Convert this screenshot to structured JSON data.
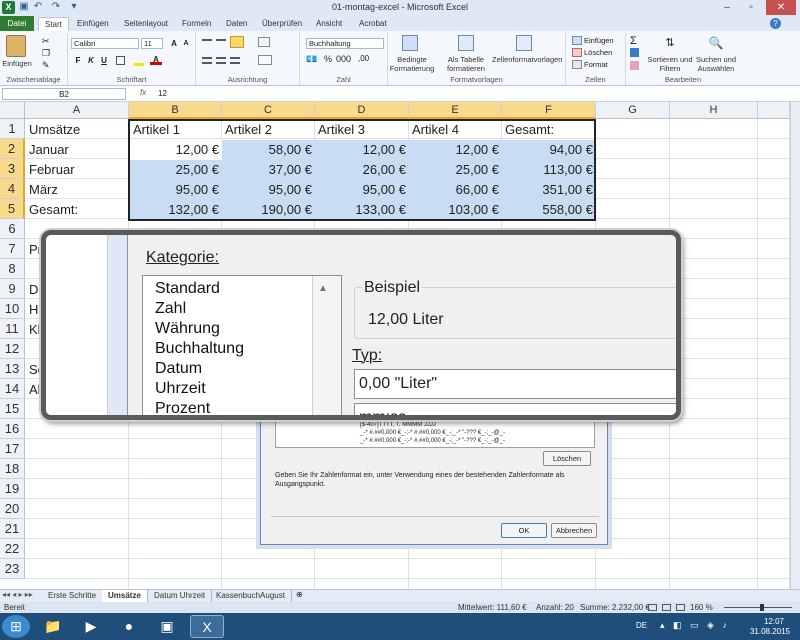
{
  "window": {
    "title": "01-montag-excel - Microsoft Excel"
  },
  "ribbon_tabs": [
    "Start",
    "Einfügen",
    "Seitenlayout",
    "Formeln",
    "Daten",
    "Überprüfen",
    "Ansicht",
    "Acrobat"
  ],
  "file_tab": "Datei",
  "ribbon": {
    "clipboard": {
      "paste": "Einfügen",
      "label": "Zwischenablage"
    },
    "font": {
      "name": "Calibri",
      "size": "11",
      "label": "Schriftart",
      "bold": "F",
      "italic": "K",
      "underline": "U"
    },
    "alignment": {
      "label": "Ausrichtung"
    },
    "number": {
      "format": "Buchhaltung",
      "label": "Zahl"
    },
    "styles": {
      "cond": "Bedingte Formatierung",
      "table": "Als Tabelle formatieren",
      "cell": "Zellenformatvorlagen",
      "label": "Formatvorlagen"
    },
    "cells": {
      "insert": "Einfügen",
      "delete": "Löschen",
      "format": "Format",
      "label": "Zellen"
    },
    "edit": {
      "sort": "Sortieren und Filtern",
      "find": "Suchen und Auswählen",
      "label": "Bearbeiten",
      "sigma": "Σ"
    }
  },
  "formula_bar": {
    "name_box": "B2",
    "fx": "fx",
    "value": "12"
  },
  "columns": [
    "A",
    "B",
    "C",
    "D",
    "E",
    "F",
    "G",
    "H"
  ],
  "rows": [
    "1",
    "2",
    "3",
    "4",
    "5",
    "6",
    "7",
    "8",
    "9",
    "10",
    "11",
    "12",
    "13",
    "14",
    "15",
    "16",
    "17",
    "18",
    "19",
    "20",
    "21",
    "22",
    "23"
  ],
  "table": {
    "headers": [
      "Umsätze",
      "Artikel 1",
      "Artikel 2",
      "Artikel 3",
      "Artikel 4",
      "Gesamt:"
    ],
    "rows": [
      [
        "Januar",
        "12,00 €",
        "58,00 €",
        "12,00 €",
        "12,00 €",
        "94,00 €"
      ],
      [
        "Februar",
        "25,00 €",
        "37,00 €",
        "26,00 €",
        "25,00 €",
        "113,00 €"
      ],
      [
        "März",
        "95,00 €",
        "95,00 €",
        "95,00 €",
        "66,00 €",
        "351,00 €"
      ],
      [
        "Gesamt:",
        "132,00 €",
        "190,00 €",
        "133,00 €",
        "103,00 €",
        "558,00 €"
      ]
    ]
  },
  "partial_cells": {
    "r7": "Pr",
    "r9": "Du",
    "r10": "Hö",
    "r11": "Kl",
    "r13": "So",
    "r14": "Ak"
  },
  "dialog": {
    "category_label": "Kategorie:",
    "categories": [
      "Standard",
      "Zahl",
      "Währung",
      "Buchhaltung",
      "Datum",
      "Uhrzeit",
      "Prozent"
    ],
    "example_label": "Beispiel",
    "example_value": "12,00 Liter",
    "type_label": "Typ:",
    "type_value": "0,00 \"Liter\"",
    "type_list_first": "mm:ss",
    "format_lines": [
      "[$-407]TTTT, T. MMMM JJJJ",
      "_-* #.##0,000 €_-;-* #.##0,000 €_-;_-* \"-??? €_-;_-@_-",
      "_-* #.##0,000 €_-;-* #.##0,000 €_-;_-* \"-??? €_-;_-@_-"
    ],
    "delete_button": "Löschen",
    "help_text": "Geben Sie Ihr Zahlenformat ein, unter Verwendung eines der bestehenden Zahlenformate als Ausgangspunkt.",
    "ok_button": "OK",
    "cancel_button": "Abbrechen"
  },
  "sheet_tabs": [
    "Erste Schritte",
    "Umsätze",
    "Datum Uhrzeit",
    "KassenbuchAugust"
  ],
  "status": {
    "mode": "Bereit",
    "average": "Mittelwert: 111,60 €",
    "count": "Anzahl: 20",
    "sum": "Summe: 2.232,00 €",
    "zoom": "160 %"
  },
  "taskbar": {
    "lang": "DE",
    "time": "12:07",
    "date": "31.08.2015"
  },
  "colors": {
    "accent_green": "#2f7d32",
    "selection": "#c8ddf3",
    "header_highlight": "#f9d98b"
  }
}
